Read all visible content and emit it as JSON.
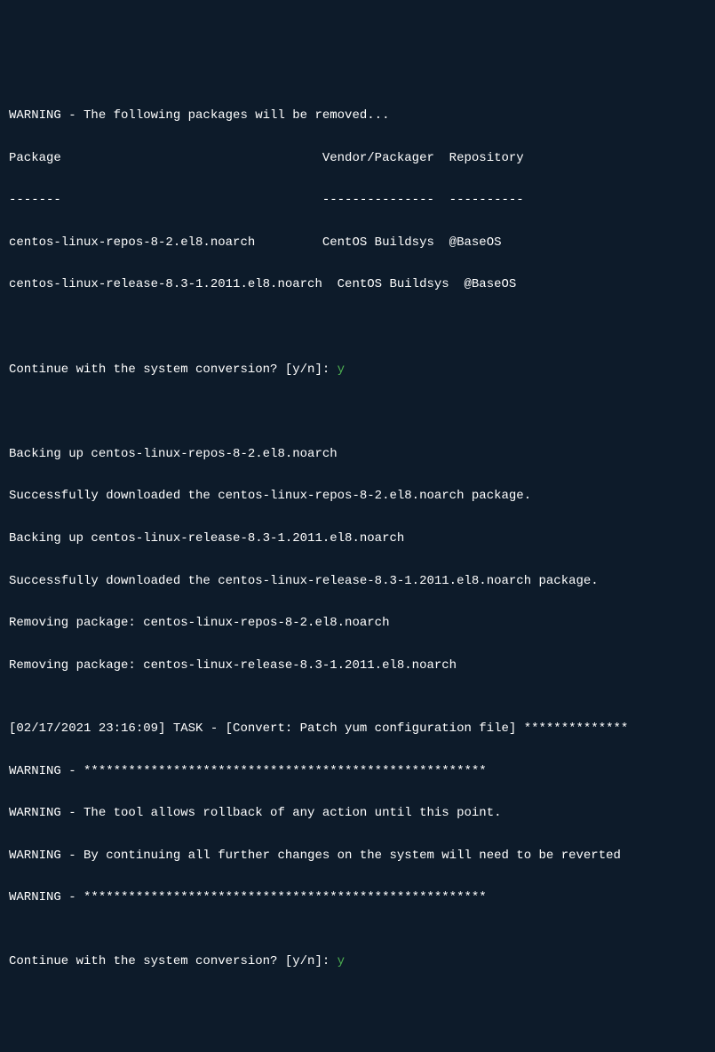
{
  "lines": {
    "l0": "WARNING - The following packages will be removed...",
    "l1": "Package                                   Vendor/Packager  Repository",
    "l2": "-------                                   ---------------  ----------",
    "l3": "centos-linux-repos-8-2.el8.noarch         CentOS Buildsys  @BaseOS",
    "l4": "centos-linux-release-8.3-1.2011.el8.noarch  CentOS Buildsys  @BaseOS",
    "l5": "",
    "l6": "",
    "l7": "Continue with the system conversion? [y/n]: ",
    "l7input": "y",
    "l8": "",
    "l9": "",
    "l10": "Backing up centos-linux-repos-8-2.el8.noarch",
    "l11": "Successfully downloaded the centos-linux-repos-8-2.el8.noarch package.",
    "l12": "Backing up centos-linux-release-8.3-1.2011.el8.noarch",
    "l13": "Successfully downloaded the centos-linux-release-8.3-1.2011.el8.noarch package.",
    "l14": "Removing package: centos-linux-repos-8-2.el8.noarch",
    "l15": "Removing package: centos-linux-release-8.3-1.2011.el8.noarch",
    "l16": "",
    "l17": "[02/17/2021 23:16:09] TASK - [Convert: Patch yum configuration file] **************",
    "l18": "WARNING - ******************************************************",
    "l19": "WARNING - The tool allows rollback of any action until this point.",
    "l20": "WARNING - By continuing all further changes on the system will need to be reverted",
    "l21": "WARNING - ******************************************************",
    "l22": "",
    "l23": "Continue with the system conversion? [y/n]: ",
    "l23input": "y"
  }
}
